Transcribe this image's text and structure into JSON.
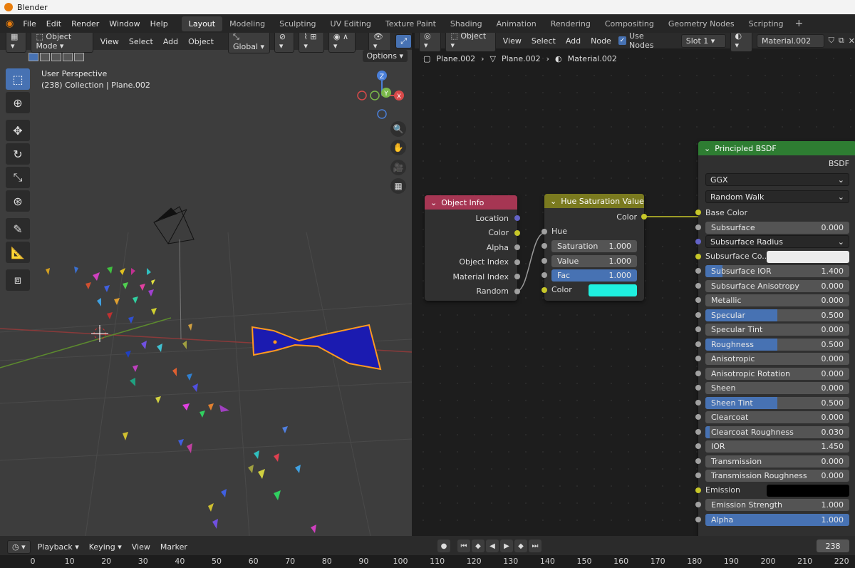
{
  "window": {
    "title": "Blender"
  },
  "menu": [
    "File",
    "Edit",
    "Render",
    "Window",
    "Help"
  ],
  "workspaces": [
    "Layout",
    "Modeling",
    "Sculpting",
    "UV Editing",
    "Texture Paint",
    "Shading",
    "Animation",
    "Rendering",
    "Compositing",
    "Geometry Nodes",
    "Scripting"
  ],
  "workspace_add": "+",
  "viewport": {
    "mode": "Object Mode",
    "menus": [
      "View",
      "Select",
      "Add",
      "Object"
    ],
    "orientation": "Global",
    "options_label": "Options",
    "info_line1": "User Perspective",
    "info_line2": "(238) Collection | Plane.002",
    "axes": {
      "z": "Z",
      "y": "Y",
      "x": "X"
    }
  },
  "node_editor": {
    "type_label": "Object",
    "menus": [
      "View",
      "Select",
      "Add",
      "Node"
    ],
    "use_nodes_label": "Use Nodes",
    "slot": "Slot 1",
    "material": "Material.002",
    "breadcrumb": [
      "Plane.002",
      "Plane.002",
      "Material.002"
    ]
  },
  "nodes": {
    "object_info": {
      "title": "Object Info",
      "outputs": [
        "Location",
        "Color",
        "Alpha",
        "Object Index",
        "Material Index",
        "Random"
      ]
    },
    "hsv": {
      "title": "Hue Saturation Value",
      "output": "Color",
      "hue": "Hue",
      "saturation": {
        "label": "Saturation",
        "value": "1.000"
      },
      "value": {
        "label": "Value",
        "value": "1.000"
      },
      "fac": {
        "label": "Fac",
        "value": "1.000"
      },
      "color_label": "Color",
      "color": "#1ff0e0"
    },
    "bsdf": {
      "title": "Principled BSDF",
      "output": "BSDF",
      "distribution": "GGX",
      "subsurface_method": "Random Walk",
      "base_color": "Base Color",
      "subsurface_radius": "Subsurface Radius",
      "subsurface_color": "Subsurface Co...",
      "emission": "Emission",
      "params": [
        {
          "label": "Subsurface",
          "value": "0.000",
          "fill": 0.0
        },
        {
          "label": "Subsurface IOR",
          "value": "1.400",
          "fill": 0.12
        },
        {
          "label": "Subsurface Anisotropy",
          "value": "0.000",
          "fill": 0.0
        },
        {
          "label": "Metallic",
          "value": "0.000",
          "fill": 0.0
        },
        {
          "label": "Specular",
          "value": "0.500",
          "fill": 0.5
        },
        {
          "label": "Specular Tint",
          "value": "0.000",
          "fill": 0.0
        },
        {
          "label": "Roughness",
          "value": "0.500",
          "fill": 0.5
        },
        {
          "label": "Anisotropic",
          "value": "0.000",
          "fill": 0.0
        },
        {
          "label": "Anisotropic Rotation",
          "value": "0.000",
          "fill": 0.0
        },
        {
          "label": "Sheen",
          "value": "0.000",
          "fill": 0.0
        },
        {
          "label": "Sheen Tint",
          "value": "0.500",
          "fill": 0.5
        },
        {
          "label": "Clearcoat",
          "value": "0.000",
          "fill": 0.0
        },
        {
          "label": "Clearcoat Roughness",
          "value": "0.030",
          "fill": 0.03
        },
        {
          "label": "IOR",
          "value": "1.450",
          "fill": 0.0
        },
        {
          "label": "Transmission",
          "value": "0.000",
          "fill": 0.0
        },
        {
          "label": "Transmission Roughness",
          "value": "0.000",
          "fill": 0.0
        }
      ],
      "emission_strength": {
        "label": "Emission Strength",
        "value": "1.000"
      },
      "alpha": {
        "label": "Alpha",
        "value": "1.000",
        "fill": 1.0
      }
    }
  },
  "timeline": {
    "menus": [
      "Playback",
      "Keying",
      "View",
      "Marker"
    ],
    "current_frame": "238",
    "ticks": [
      "0",
      "10",
      "20",
      "30",
      "40",
      "50",
      "60",
      "70",
      "80",
      "90",
      "100",
      "110",
      "120",
      "130",
      "140",
      "150",
      "160",
      "170",
      "180",
      "190",
      "200",
      "210",
      "220"
    ]
  },
  "colors": {
    "object_info_header": "#a63653",
    "hsv_header": "#7a7a1f",
    "bsdf_header": "#2e7d32",
    "accent": "#4772b3",
    "selection": "#ff9a1f",
    "plane": "#1b1bb0"
  }
}
